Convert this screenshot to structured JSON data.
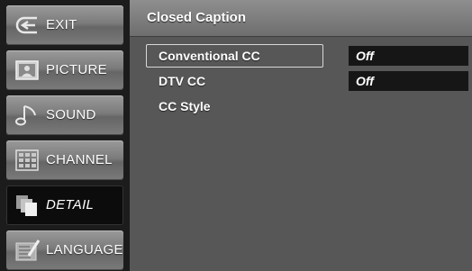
{
  "sidebar": {
    "items": [
      {
        "label": "EXIT",
        "icon": "exit-arrow-icon",
        "active": false
      },
      {
        "label": "PICTURE",
        "icon": "picture-icon",
        "active": false
      },
      {
        "label": "SOUND",
        "icon": "music-note-icon",
        "active": false
      },
      {
        "label": "CHANNEL",
        "icon": "channel-grid-icon",
        "active": false
      },
      {
        "label": "DETAIL",
        "icon": "detail-pages-icon",
        "active": true
      },
      {
        "label": "LANGUAGE",
        "icon": "language-icon",
        "active": false
      }
    ]
  },
  "panel": {
    "title": "Closed Caption",
    "options": [
      {
        "label": "Conventional CC",
        "value": "Off",
        "selected": true
      },
      {
        "label": "DTV CC",
        "value": "Off",
        "selected": false
      },
      {
        "label": "CC Style",
        "value": null,
        "selected": false
      }
    ]
  },
  "colors": {
    "sidebar_bg": "#1c1c1c",
    "menu_button": "#7b7b7b",
    "active_button": "#0c0c0c",
    "panel_bg": "#575757",
    "value_box": "#161616",
    "text": "#ffffff"
  }
}
